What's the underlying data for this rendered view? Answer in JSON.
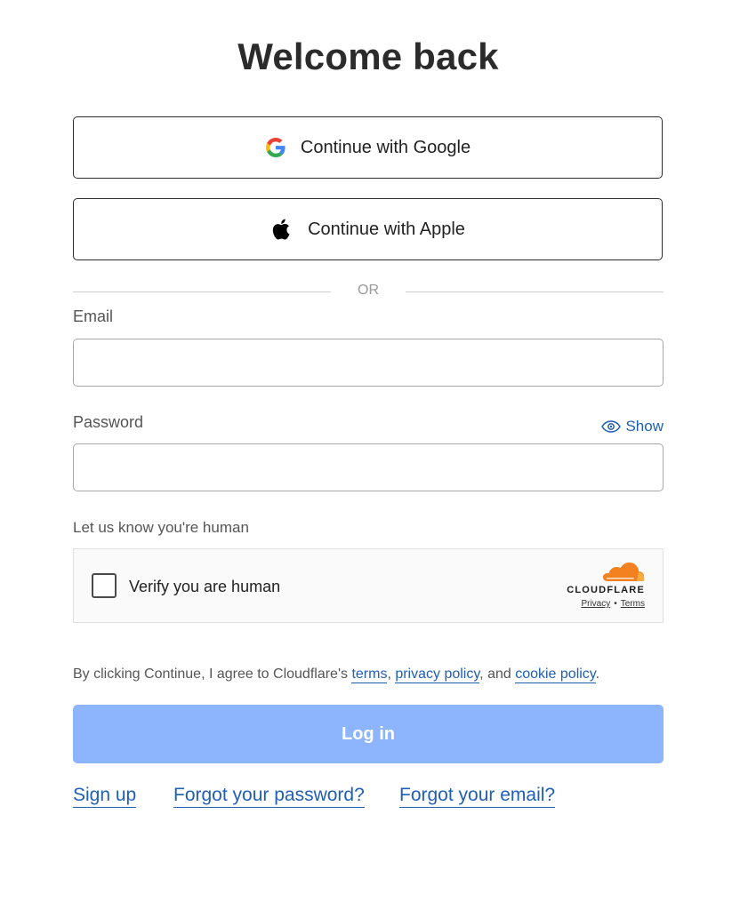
{
  "title": "Welcome back",
  "sso": {
    "google_label": "Continue with Google",
    "google_icon": "google-g-icon",
    "apple_label": "Continue with Apple",
    "apple_icon": "apple-logo-icon"
  },
  "divider": {
    "text": "OR"
  },
  "email": {
    "label": "Email",
    "value": "",
    "placeholder": ""
  },
  "password": {
    "label": "Password",
    "value": "",
    "placeholder": "",
    "show_label": "Show",
    "show_icon": "eye-icon"
  },
  "captcha": {
    "section_label": "Let us know you're human",
    "checkbox_label": "Verify you are human",
    "checked": false,
    "brand": "CLOUDFLARE",
    "privacy_link": "Privacy",
    "separator": "•",
    "terms_link": "Terms"
  },
  "agreement": {
    "prefix": "By clicking Continue, I agree to Cloudflare's ",
    "terms": "terms",
    "sep1": ", ",
    "privacy": "privacy policy",
    "sep2": ", and ",
    "cookie": "cookie policy",
    "suffix": "."
  },
  "login_button": "Log in",
  "links": {
    "sign_up": "Sign up",
    "forgot_password": "Forgot your password?",
    "forgot_email": "Forgot your email?"
  },
  "colors": {
    "link": "#1f5fb5",
    "login_button_bg": "#8db5fd",
    "cloudflare_orange": "#f48120"
  }
}
